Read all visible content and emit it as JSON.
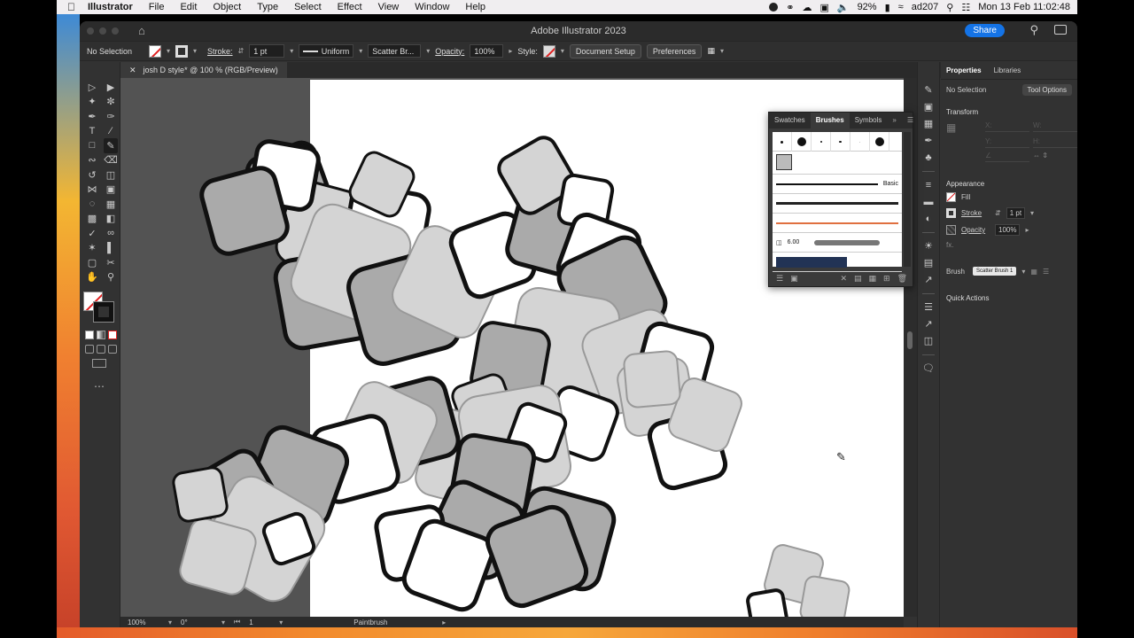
{
  "menubar": {
    "app": "Illustrator",
    "items": [
      "File",
      "Edit",
      "Object",
      "Type",
      "Select",
      "Effect",
      "View",
      "Window",
      "Help"
    ],
    "battery": "92%",
    "user": "ad207",
    "datetime": "Mon 13 Feb  11:02:48"
  },
  "window": {
    "title": "Adobe Illustrator 2023",
    "share": "Share"
  },
  "controlbar": {
    "selection": "No Selection",
    "stroke_label": "Stroke:",
    "stroke_value": "1 pt",
    "profile": "Uniform",
    "brush": "Scatter Br...",
    "opacity_label": "Opacity:",
    "opacity_value": "100%",
    "style_label": "Style:",
    "document_setup": "Document Setup",
    "preferences": "Preferences"
  },
  "document": {
    "tab_title": "josh D style* @ 100 % (RGB/Preview)"
  },
  "statusbar": {
    "zoom": "100%",
    "rotation": "0°",
    "artboard": "1",
    "tool": "Paintbrush"
  },
  "brushes_panel": {
    "tabs": [
      "Swatches",
      "Brushes",
      "Symbols"
    ],
    "basic_label": "Basic",
    "brush_size": "6.00"
  },
  "properties": {
    "tabs": [
      "Properties",
      "Libraries"
    ],
    "selection": "No Selection",
    "tool_options": "Tool Options",
    "transform": "Transform",
    "x": "X:",
    "y": "Y:",
    "w": "W:",
    "h": "H:",
    "appearance": "Appearance",
    "fill": "Fill",
    "stroke": "Stroke",
    "stroke_value": "1 pt",
    "opacity": "Opacity",
    "opacity_value": "100%",
    "fx": "fx.",
    "brush_label": "Brush",
    "brush_value": "Scatter Brush 1",
    "quick_actions": "Quick Actions"
  },
  "colors": {
    "accent": "#1473e6",
    "panel": "#323232",
    "pasteboard": "#535353",
    "square_dark": "#aaaaaa",
    "square_light": "#d4d4d4"
  }
}
